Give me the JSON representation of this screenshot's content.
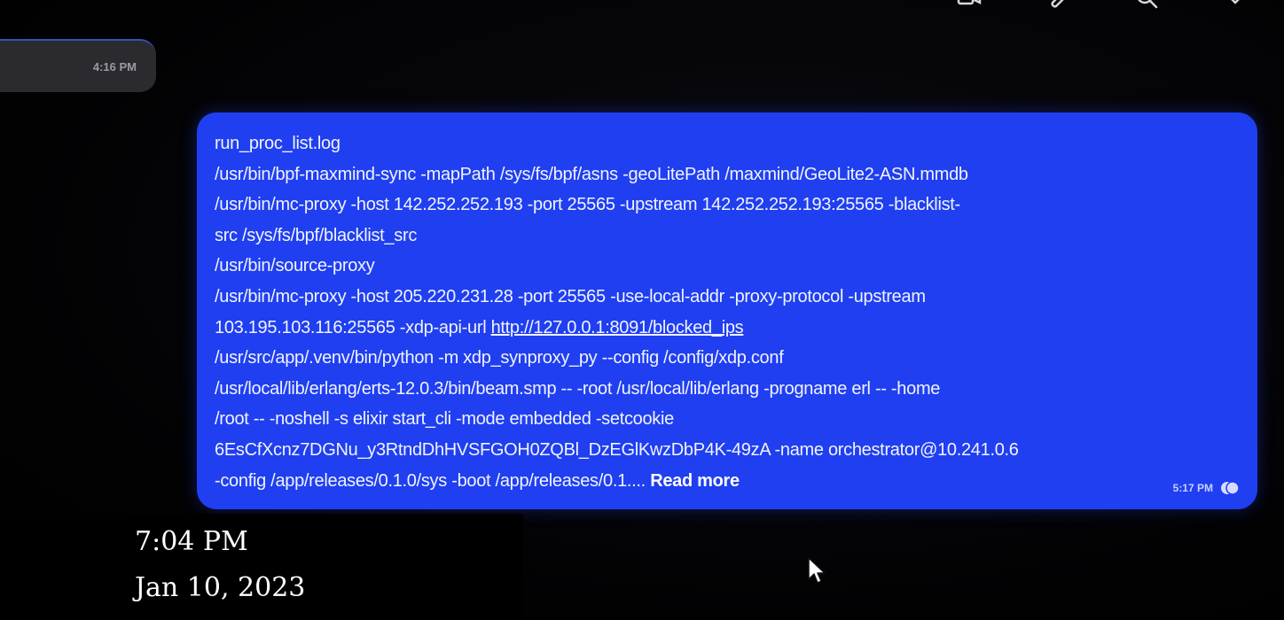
{
  "header": {
    "icons": [
      "video-call-icon",
      "attachment-icon",
      "search-icon",
      "more-icon"
    ]
  },
  "previous_message": {
    "time": "4:16 PM"
  },
  "message": {
    "lines": [
      "run_proc_list.log",
      "/usr/bin/bpf-maxmind-sync -mapPath /sys/fs/bpf/asns -geoLitePath /maxmind/GeoLite2-ASN.mmdb",
      "/usr/bin/mc-proxy -host 142.252.252.193 -port 25565 -upstream 142.252.252.193:25565 -blacklist-",
      "src /sys/fs/bpf/blacklist_src",
      "/usr/bin/source-proxy",
      "/usr/bin/mc-proxy -host 205.220.231.28 -port 25565 -use-local-addr -proxy-protocol -upstream"
    ],
    "line7_prefix": "103.195.103.116:25565 -xdp-api-url ",
    "link": "http://127.0.0.1:8091/blocked_ips",
    "lines_after": [
      "/usr/src/app/.venv/bin/python -m xdp_synproxy_py --config /config/xdp.conf",
      "/usr/local/lib/erlang/erts-12.0.3/bin/beam.smp -- -root /usr/local/lib/erlang -progname erl -- -home",
      "/root -- -noshell -s elixir start_cli -mode embedded -setcookie",
      "6EsCfXcnz7DGNu_y3RtndDhHVSFGOH0ZQBl_DzEGlKwzDbP4K-49zA -name orchestrator@10.241.0.6"
    ],
    "last_line_prefix": "-config /app/releases/0.1.0/sys -boot /app/releases/0.1.... ",
    "read_more": "Read more",
    "time": "5:17 PM",
    "status_icon": "read-receipt-icon",
    "bubble_color": "#1f3ff0"
  },
  "overlay": {
    "time": "7:04 PM",
    "date": "Jan 10, 2023"
  }
}
